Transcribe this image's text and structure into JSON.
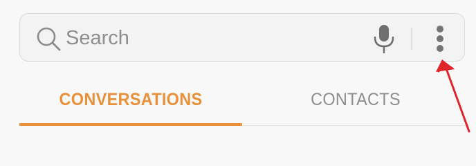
{
  "search": {
    "placeholder": "Search",
    "value": ""
  },
  "icons": {
    "search": "search-icon",
    "mic": "mic-icon",
    "more": "more-vertical-icon"
  },
  "tabs": [
    {
      "label": "CONVERSATIONS",
      "active": true
    },
    {
      "label": "CONTACTS",
      "active": false
    }
  ],
  "colors": {
    "accent": "#e8913a",
    "inactive_tab": "#8d8d8d",
    "annotation_arrow": "#e0242b"
  }
}
